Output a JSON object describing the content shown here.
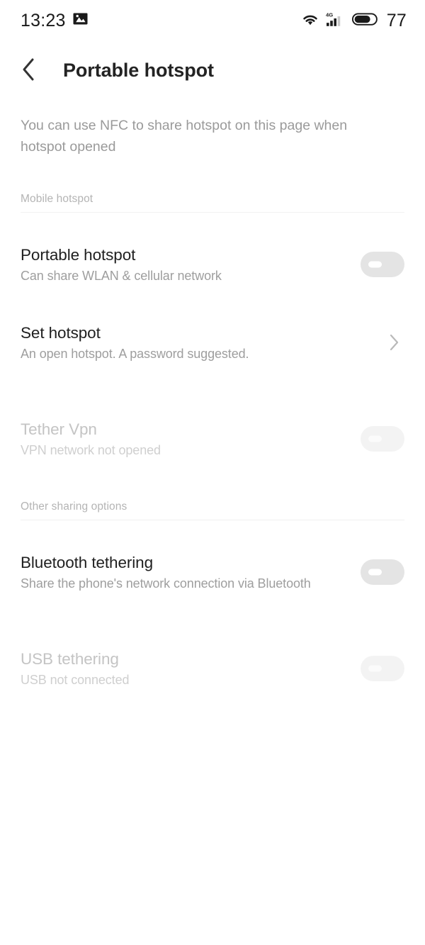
{
  "status_bar": {
    "time": "13:23",
    "notification_icon": "image-notification-icon",
    "wifi_icon": "wifi-icon",
    "signal_icon": "signal-4g-icon",
    "signal_label": "4G",
    "battery_icon": "battery-icon",
    "battery_level": "77"
  },
  "header": {
    "back_icon": "chevron-left-icon",
    "title": "Portable hotspot"
  },
  "notice": {
    "text": "You can use NFC to share hotspot on this page when hotspot opened"
  },
  "sections": [
    {
      "title": "Mobile hotspot",
      "rows": [
        {
          "name": "portable-hotspot",
          "title": "Portable hotspot",
          "subtitle": "Can share WLAN & cellular network",
          "control": "toggle",
          "toggle_state": "off",
          "enabled": true
        },
        {
          "name": "set-hotspot",
          "title": "Set hotspot",
          "subtitle": "An open hotspot. A password suggested.",
          "control": "chevron",
          "chevron_icon": "chevron-right-icon",
          "enabled": true
        },
        {
          "name": "tether-vpn",
          "title": "Tether Vpn",
          "subtitle": "VPN network not opened",
          "control": "toggle",
          "toggle_state": "off",
          "enabled": false
        }
      ]
    },
    {
      "title": "Other sharing options",
      "rows": [
        {
          "name": "bluetooth-tethering",
          "title": "Bluetooth tethering",
          "subtitle": "Share the phone's network connection via Bluetooth",
          "control": "toggle",
          "toggle_state": "off",
          "enabled": true
        },
        {
          "name": "usb-tethering",
          "title": "USB tethering",
          "subtitle": "USB not connected",
          "control": "toggle",
          "toggle_state": "off",
          "enabled": false
        }
      ]
    }
  ],
  "colors": {
    "background": "#ffffff",
    "title_text": "#232323",
    "body_text": "#1f1f1f",
    "secondary_text": "#9e9e9e",
    "muted_text": "#c4c4c4",
    "section_label": "#b4b4b4",
    "divider": "#f1f1f1",
    "toggle_off_track": "#e4e4e4",
    "toggle_disabled_track": "#f3f3f3"
  }
}
